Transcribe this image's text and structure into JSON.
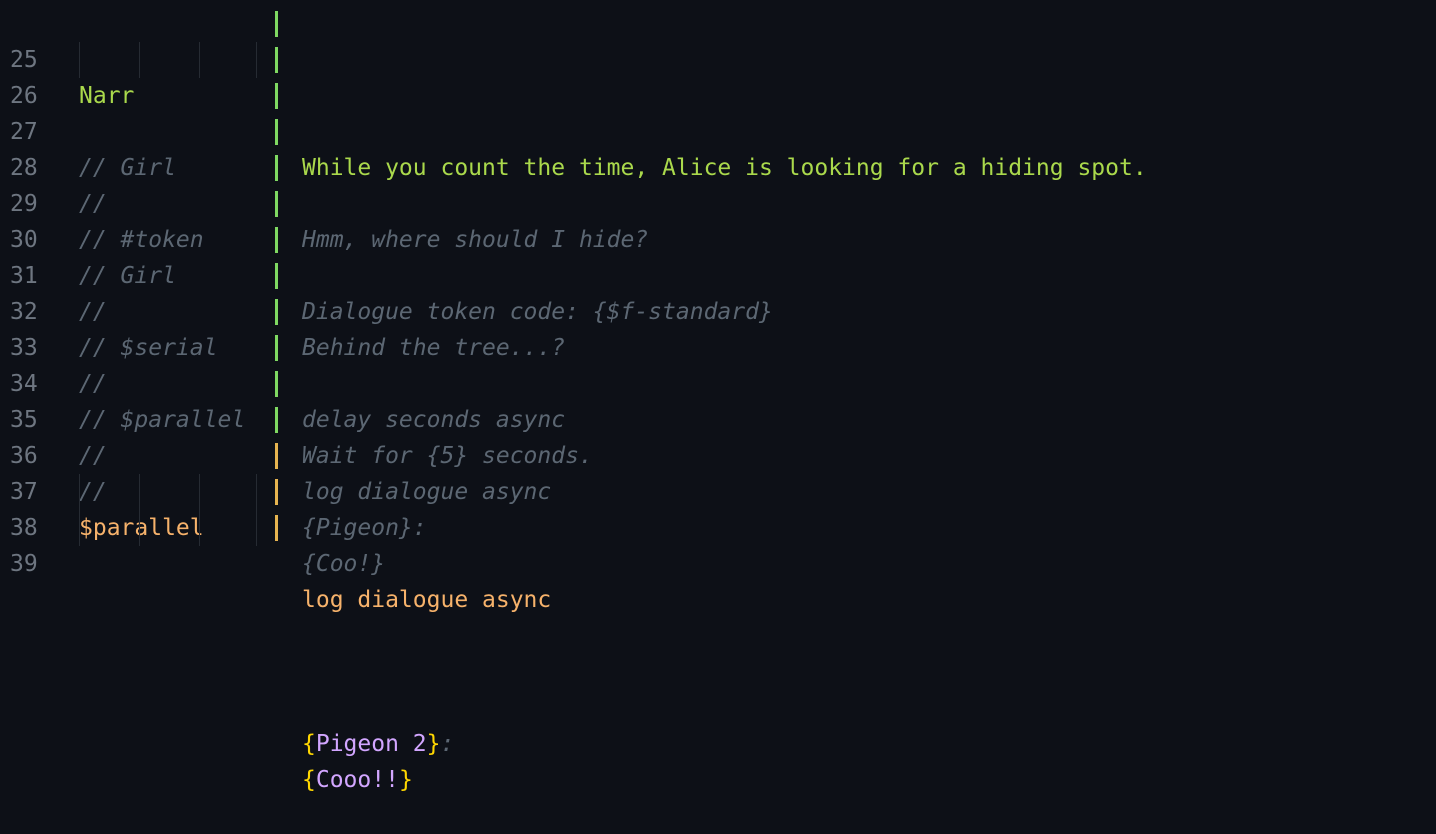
{
  "lines": [
    {
      "num": "25",
      "speaker": "Narr",
      "text": "While you count the time, Alice is looking for a hiding spot."
    },
    {
      "num": "26",
      "speaker": "",
      "text": ""
    },
    {
      "num": "27",
      "speaker": "// Girl",
      "text": "Hmm, where should I hide?"
    },
    {
      "num": "28",
      "speaker": "//",
      "text": ""
    },
    {
      "num": "29",
      "speaker": "// #token",
      "text": "Dialogue token code: {$f-standard}"
    },
    {
      "num": "30",
      "speaker": "// Girl",
      "text": "Behind the tree...?"
    },
    {
      "num": "31",
      "speaker": "//",
      "text": ""
    },
    {
      "num": "32",
      "speaker": "// $serial",
      "text": "delay seconds async"
    },
    {
      "num": "33",
      "speaker": "//",
      "text": "Wait for {5} seconds."
    },
    {
      "num": "34",
      "speaker": "// $parallel",
      "text": "log dialogue async"
    },
    {
      "num": "35",
      "speaker": "//",
      "text": "{Pigeon}:"
    },
    {
      "num": "36",
      "speaker": "//",
      "text": "{Coo!}"
    },
    {
      "num": "37",
      "speaker": "$parallel",
      "text": "log dialogue async"
    },
    {
      "num": "38",
      "speaker": "",
      "text_parts": [
        "{",
        "Pigeon 2",
        "}",
        ":"
      ]
    },
    {
      "num": "39",
      "speaker": "",
      "text_parts": [
        "{",
        "Cooo!!",
        "}"
      ]
    }
  ],
  "colors": {
    "background": "#0d1017",
    "line_number": "#6e7681",
    "narration": "#aad94c",
    "comment": "#5c6773",
    "command": "#f6b26b",
    "brace": "#ffd700",
    "dialogue": "#d2a6ff",
    "bar_green": "#7fd962",
    "bar_orange": "#e6b450"
  }
}
